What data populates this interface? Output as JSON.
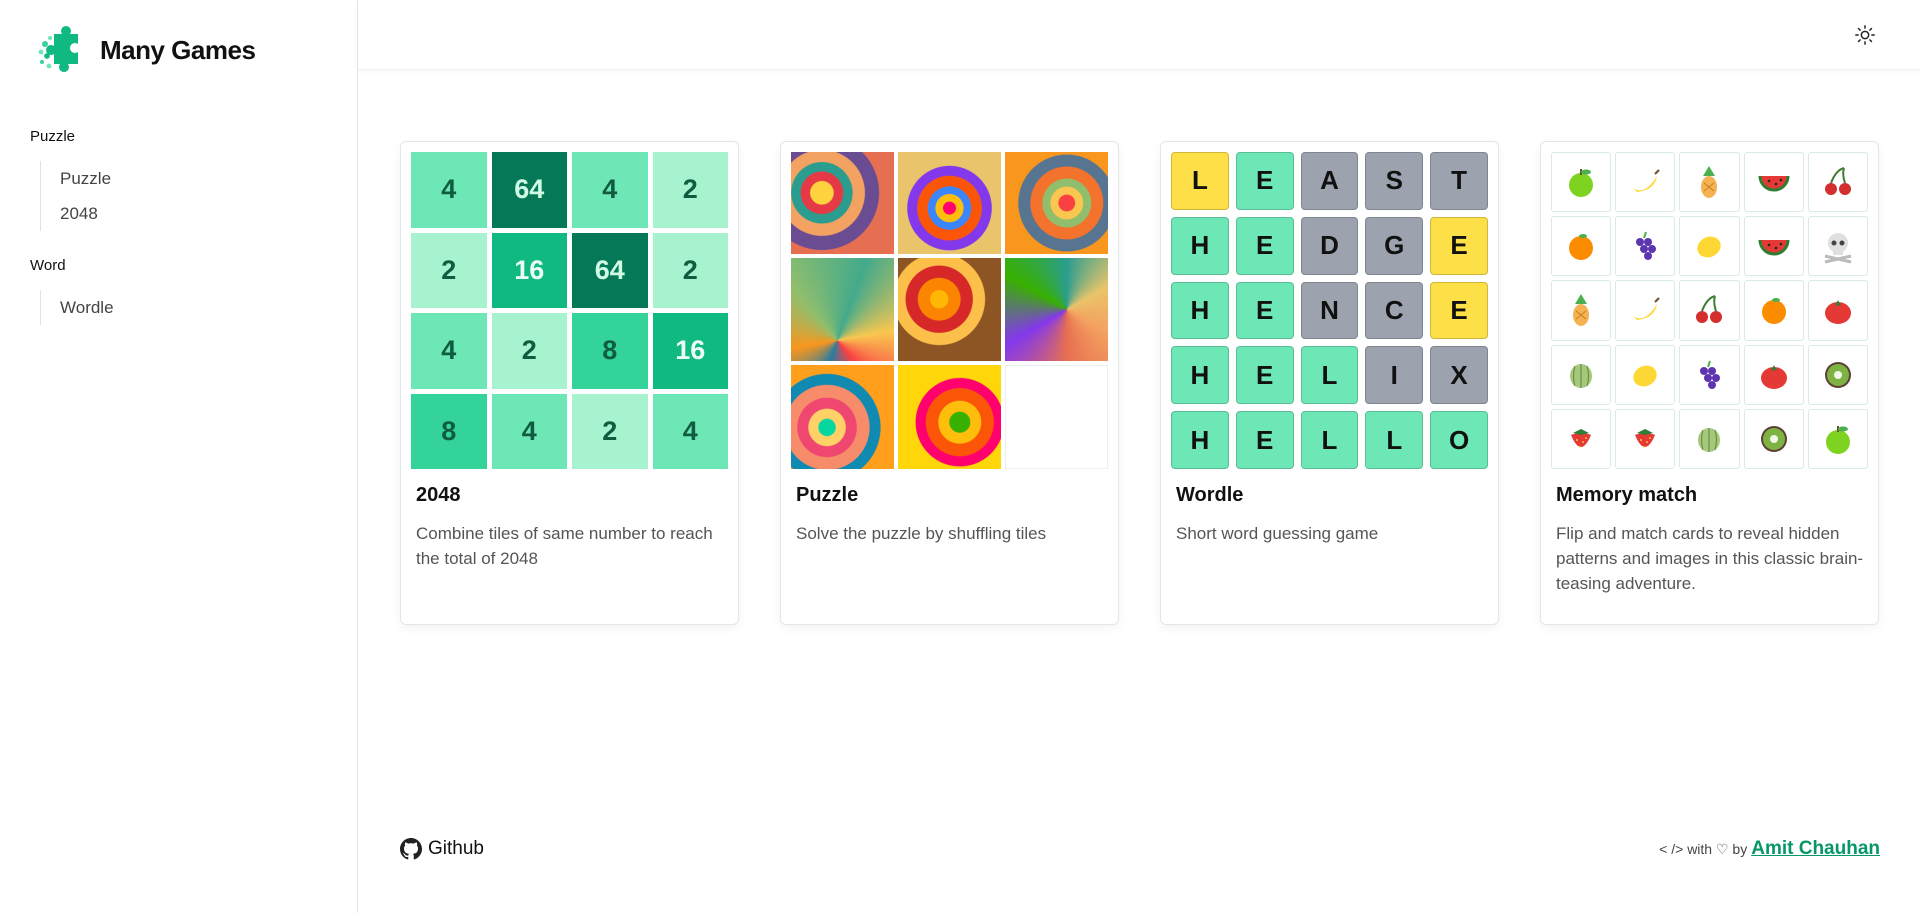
{
  "app": {
    "name": "Many Games"
  },
  "sidebar": {
    "groups": [
      {
        "title": "Puzzle",
        "items": [
          {
            "label": "Puzzle"
          },
          {
            "label": "2048"
          }
        ]
      },
      {
        "title": "Word",
        "items": [
          {
            "label": "Wordle"
          }
        ]
      }
    ]
  },
  "header": {
    "theme_toggle_icon": "sun-icon"
  },
  "cards": [
    {
      "title": "2048",
      "description": "Combine tiles of same number to reach the total of 2048",
      "tiles": [
        [
          "4",
          "64",
          "4",
          "2"
        ],
        [
          "2",
          "16",
          "64",
          "2"
        ],
        [
          "4",
          "2",
          "8",
          "16"
        ],
        [
          "8",
          "4",
          "2",
          "4"
        ]
      ]
    },
    {
      "title": "Puzzle",
      "description": "Solve the puzzle by shuffling tiles"
    },
    {
      "title": "Wordle",
      "description": "Short word guessing game",
      "rows": [
        {
          "letters": [
            "L",
            "E",
            "A",
            "S",
            "T"
          ],
          "states": [
            "present",
            "correct",
            "absent",
            "absent",
            "absent"
          ]
        },
        {
          "letters": [
            "H",
            "E",
            "D",
            "G",
            "E"
          ],
          "states": [
            "correct",
            "correct",
            "absent",
            "absent",
            "present"
          ]
        },
        {
          "letters": [
            "H",
            "E",
            "N",
            "C",
            "E"
          ],
          "states": [
            "correct",
            "correct",
            "absent",
            "absent",
            "present"
          ]
        },
        {
          "letters": [
            "H",
            "E",
            "L",
            "I",
            "X"
          ],
          "states": [
            "correct",
            "correct",
            "correct",
            "absent",
            "absent"
          ]
        },
        {
          "letters": [
            "H",
            "E",
            "L",
            "L",
            "O"
          ],
          "states": [
            "correct",
            "correct",
            "correct",
            "correct",
            "correct"
          ]
        }
      ]
    },
    {
      "title": "Memory match",
      "description": "Flip and match cards to reveal hidden patterns and images in this classic brain-teasing adventure.",
      "cards": [
        [
          "green-apple-icon",
          "banana-icon",
          "pineapple-icon",
          "watermelon-icon",
          "cherries-icon"
        ],
        [
          "orange-icon",
          "grapes-icon",
          "lemon-icon",
          "watermelon-icon",
          "skull-crossbones-icon"
        ],
        [
          "pineapple-icon",
          "banana-icon",
          "cherries-icon",
          "orange-icon",
          "tomato-icon"
        ],
        [
          "melon-icon",
          "lemon-icon",
          "grapes-icon",
          "tomato-icon",
          "kiwi-icon"
        ],
        [
          "strawberry-icon",
          "strawberry-icon",
          "melon-icon",
          "kiwi-icon",
          "green-apple-icon"
        ]
      ]
    }
  ],
  "footer": {
    "github_label": "Github",
    "credit_prefix": "< /> with ♡ by",
    "author": "Amit Chauhan"
  },
  "colors": {
    "accent": "#059669",
    "tile_2": "#a7f3d0",
    "tile_4": "#6ee7b7",
    "tile_8": "#34d399",
    "tile_16": "#10b981",
    "tile_64": "#047857",
    "wordle_correct": "#6ee7b7",
    "wordle_present": "#fde047",
    "wordle_absent": "#9ca3af"
  }
}
